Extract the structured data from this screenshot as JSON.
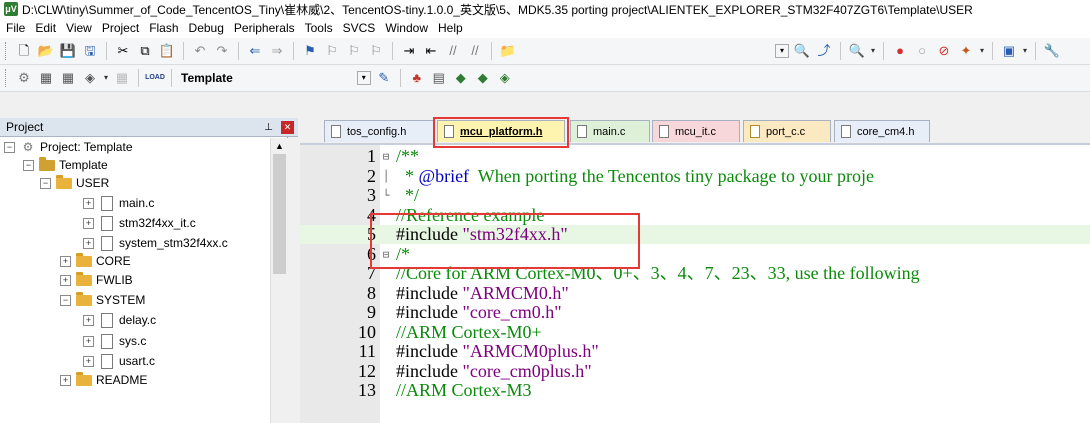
{
  "window": {
    "title": "D:\\CLW\\tiny\\Summer_of_Code_TencentOS_Tiny\\崔林威\\2、TencentOS-tiny.1.0.0_英文版\\5、MDK5.35 porting project\\ALIENTEK_EXPLORER_STM32F407ZGT6\\Template\\USER"
  },
  "menu": [
    "File",
    "Edit",
    "View",
    "Project",
    "Flash",
    "Debug",
    "Peripherals",
    "Tools",
    "SVCS",
    "Window",
    "Help"
  ],
  "toolbar2": {
    "target": "Template",
    "load_label": "LOAD"
  },
  "project_panel": {
    "title": "Project",
    "tree": [
      {
        "label": "Project: Template",
        "type": "project",
        "expand": "−"
      },
      {
        "label": "Template",
        "type": "target",
        "expand": "−"
      },
      {
        "label": "USER",
        "type": "folder",
        "expand": "−"
      },
      {
        "label": "main.c",
        "type": "file",
        "expand": "+"
      },
      {
        "label": "stm32f4xx_it.c",
        "type": "file",
        "expand": "+"
      },
      {
        "label": "system_stm32f4xx.c",
        "type": "file",
        "expand": "+"
      },
      {
        "label": "CORE",
        "type": "folder",
        "expand": "+"
      },
      {
        "label": "FWLIB",
        "type": "folder",
        "expand": "+"
      },
      {
        "label": "SYSTEM",
        "type": "folder",
        "expand": "−"
      },
      {
        "label": "delay.c",
        "type": "file",
        "expand": "+"
      },
      {
        "label": "sys.c",
        "type": "file",
        "expand": "+"
      },
      {
        "label": "usart.c",
        "type": "file",
        "expand": "+"
      },
      {
        "label": "README",
        "type": "folder",
        "expand": "+"
      }
    ]
  },
  "tabs": [
    {
      "label": "tos_config.h",
      "color": "#e8eef8"
    },
    {
      "label": "mcu_platform.h",
      "color": "#fff3b0",
      "active": true
    },
    {
      "label": "main.c",
      "color": "#dff0d8"
    },
    {
      "label": "mcu_it.c",
      "color": "#f8d7da"
    },
    {
      "label": "port_c.c",
      "color": "#fbe9c2"
    },
    {
      "label": "core_cm4.h",
      "color": "#e8eef8"
    }
  ],
  "editor": {
    "lines": [
      {
        "n": "1",
        "fold": "⊟",
        "parts": [
          {
            "t": "/**",
            "c": "c-comment"
          }
        ]
      },
      {
        "n": "2",
        "fold": "│",
        "parts": [
          {
            "t": "  * ",
            "c": "c-comment"
          },
          {
            "t": "@brief",
            "c": "c-doctag"
          },
          {
            "t": "  When porting the Tencentos tiny package to your proje",
            "c": "c-comment"
          }
        ]
      },
      {
        "n": "3",
        "fold": "└",
        "parts": [
          {
            "t": "  */",
            "c": "c-comment"
          }
        ]
      },
      {
        "n": "4",
        "fold": "",
        "parts": [
          {
            "t": "//Reference example",
            "c": "c-comment"
          }
        ]
      },
      {
        "n": "5",
        "fold": "",
        "current": true,
        "parts": [
          {
            "t": "#include ",
            "c": "c-pre"
          },
          {
            "t": "\"stm32f4xx.h\"",
            "c": "c-str"
          }
        ]
      },
      {
        "n": "6",
        "fold": "⊟",
        "parts": [
          {
            "t": "/*",
            "c": "c-comment"
          }
        ]
      },
      {
        "n": "7",
        "fold": "",
        "parts": [
          {
            "t": "//Core for ARM Cortex-M0、0+、3、4、7、23、33, use the following",
            "c": "c-comment"
          }
        ]
      },
      {
        "n": "8",
        "fold": "",
        "parts": [
          {
            "t": "#include ",
            "c": "c-pre"
          },
          {
            "t": "\"ARMCM0.h\"",
            "c": "c-str"
          }
        ]
      },
      {
        "n": "9",
        "fold": "",
        "parts": [
          {
            "t": "#include ",
            "c": "c-pre"
          },
          {
            "t": "\"core_cm0.h\"",
            "c": "c-str"
          }
        ]
      },
      {
        "n": "10",
        "fold": "",
        "parts": [
          {
            "t": "//ARM Cortex-M0+",
            "c": "c-comment"
          }
        ]
      },
      {
        "n": "11",
        "fold": "",
        "parts": [
          {
            "t": "#include ",
            "c": "c-pre"
          },
          {
            "t": "\"ARMCM0plus.h\"",
            "c": "c-str"
          }
        ]
      },
      {
        "n": "12",
        "fold": "",
        "parts": [
          {
            "t": "#include ",
            "c": "c-pre"
          },
          {
            "t": "\"core_cm0plus.h\"",
            "c": "c-str"
          }
        ]
      },
      {
        "n": "13",
        "fold": "",
        "parts": [
          {
            "t": "//ARM Cortex-M3",
            "c": "c-comment"
          }
        ]
      }
    ]
  },
  "colors": {
    "highlight_box": "#e53935",
    "comment": "#0a8a0a",
    "string": "#800080",
    "gutter": "#e9e9e9"
  }
}
